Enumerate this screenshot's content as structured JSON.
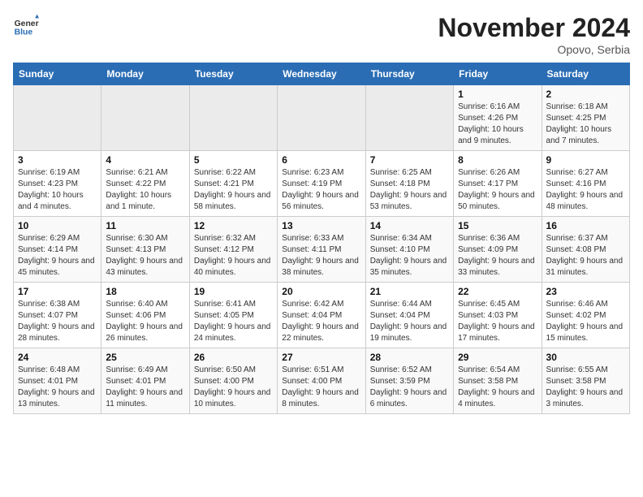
{
  "header": {
    "logo_general": "General",
    "logo_blue": "Blue",
    "month_title": "November 2024",
    "location": "Opovo, Serbia"
  },
  "weekdays": [
    "Sunday",
    "Monday",
    "Tuesday",
    "Wednesday",
    "Thursday",
    "Friday",
    "Saturday"
  ],
  "weeks": [
    [
      {
        "day": "",
        "info": ""
      },
      {
        "day": "",
        "info": ""
      },
      {
        "day": "",
        "info": ""
      },
      {
        "day": "",
        "info": ""
      },
      {
        "day": "",
        "info": ""
      },
      {
        "day": "1",
        "info": "Sunrise: 6:16 AM\nSunset: 4:26 PM\nDaylight: 10 hours and 9 minutes."
      },
      {
        "day": "2",
        "info": "Sunrise: 6:18 AM\nSunset: 4:25 PM\nDaylight: 10 hours and 7 minutes."
      }
    ],
    [
      {
        "day": "3",
        "info": "Sunrise: 6:19 AM\nSunset: 4:23 PM\nDaylight: 10 hours and 4 minutes."
      },
      {
        "day": "4",
        "info": "Sunrise: 6:21 AM\nSunset: 4:22 PM\nDaylight: 10 hours and 1 minute."
      },
      {
        "day": "5",
        "info": "Sunrise: 6:22 AM\nSunset: 4:21 PM\nDaylight: 9 hours and 58 minutes."
      },
      {
        "day": "6",
        "info": "Sunrise: 6:23 AM\nSunset: 4:19 PM\nDaylight: 9 hours and 56 minutes."
      },
      {
        "day": "7",
        "info": "Sunrise: 6:25 AM\nSunset: 4:18 PM\nDaylight: 9 hours and 53 minutes."
      },
      {
        "day": "8",
        "info": "Sunrise: 6:26 AM\nSunset: 4:17 PM\nDaylight: 9 hours and 50 minutes."
      },
      {
        "day": "9",
        "info": "Sunrise: 6:27 AM\nSunset: 4:16 PM\nDaylight: 9 hours and 48 minutes."
      }
    ],
    [
      {
        "day": "10",
        "info": "Sunrise: 6:29 AM\nSunset: 4:14 PM\nDaylight: 9 hours and 45 minutes."
      },
      {
        "day": "11",
        "info": "Sunrise: 6:30 AM\nSunset: 4:13 PM\nDaylight: 9 hours and 43 minutes."
      },
      {
        "day": "12",
        "info": "Sunrise: 6:32 AM\nSunset: 4:12 PM\nDaylight: 9 hours and 40 minutes."
      },
      {
        "day": "13",
        "info": "Sunrise: 6:33 AM\nSunset: 4:11 PM\nDaylight: 9 hours and 38 minutes."
      },
      {
        "day": "14",
        "info": "Sunrise: 6:34 AM\nSunset: 4:10 PM\nDaylight: 9 hours and 35 minutes."
      },
      {
        "day": "15",
        "info": "Sunrise: 6:36 AM\nSunset: 4:09 PM\nDaylight: 9 hours and 33 minutes."
      },
      {
        "day": "16",
        "info": "Sunrise: 6:37 AM\nSunset: 4:08 PM\nDaylight: 9 hours and 31 minutes."
      }
    ],
    [
      {
        "day": "17",
        "info": "Sunrise: 6:38 AM\nSunset: 4:07 PM\nDaylight: 9 hours and 28 minutes."
      },
      {
        "day": "18",
        "info": "Sunrise: 6:40 AM\nSunset: 4:06 PM\nDaylight: 9 hours and 26 minutes."
      },
      {
        "day": "19",
        "info": "Sunrise: 6:41 AM\nSunset: 4:05 PM\nDaylight: 9 hours and 24 minutes."
      },
      {
        "day": "20",
        "info": "Sunrise: 6:42 AM\nSunset: 4:04 PM\nDaylight: 9 hours and 22 minutes."
      },
      {
        "day": "21",
        "info": "Sunrise: 6:44 AM\nSunset: 4:04 PM\nDaylight: 9 hours and 19 minutes."
      },
      {
        "day": "22",
        "info": "Sunrise: 6:45 AM\nSunset: 4:03 PM\nDaylight: 9 hours and 17 minutes."
      },
      {
        "day": "23",
        "info": "Sunrise: 6:46 AM\nSunset: 4:02 PM\nDaylight: 9 hours and 15 minutes."
      }
    ],
    [
      {
        "day": "24",
        "info": "Sunrise: 6:48 AM\nSunset: 4:01 PM\nDaylight: 9 hours and 13 minutes."
      },
      {
        "day": "25",
        "info": "Sunrise: 6:49 AM\nSunset: 4:01 PM\nDaylight: 9 hours and 11 minutes."
      },
      {
        "day": "26",
        "info": "Sunrise: 6:50 AM\nSunset: 4:00 PM\nDaylight: 9 hours and 10 minutes."
      },
      {
        "day": "27",
        "info": "Sunrise: 6:51 AM\nSunset: 4:00 PM\nDaylight: 9 hours and 8 minutes."
      },
      {
        "day": "28",
        "info": "Sunrise: 6:52 AM\nSunset: 3:59 PM\nDaylight: 9 hours and 6 minutes."
      },
      {
        "day": "29",
        "info": "Sunrise: 6:54 AM\nSunset: 3:58 PM\nDaylight: 9 hours and 4 minutes."
      },
      {
        "day": "30",
        "info": "Sunrise: 6:55 AM\nSunset: 3:58 PM\nDaylight: 9 hours and 3 minutes."
      }
    ]
  ]
}
